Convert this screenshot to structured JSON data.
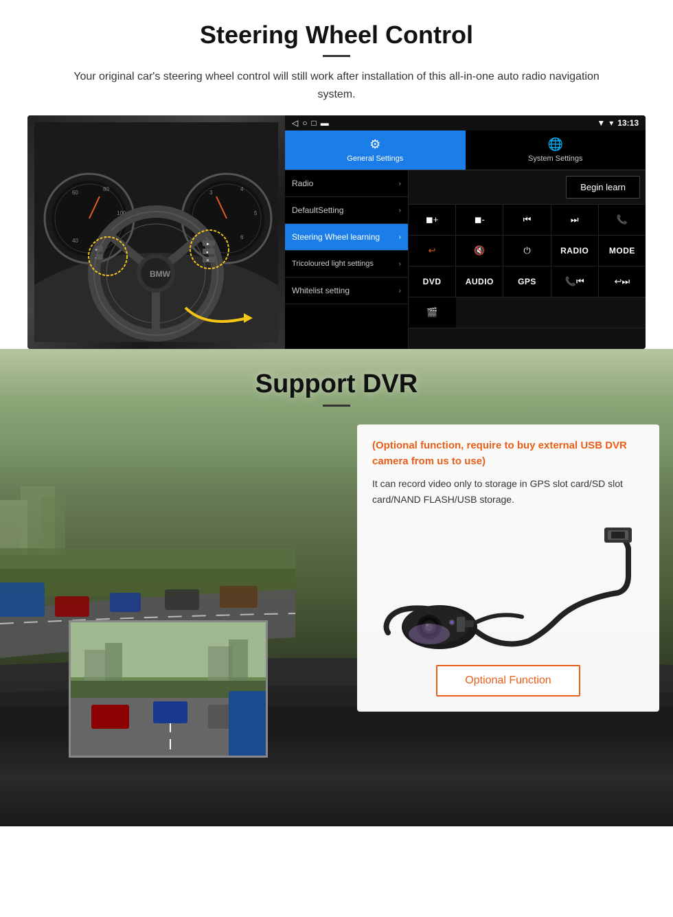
{
  "steering": {
    "title": "Steering Wheel Control",
    "subtitle": "Your original car's steering wheel control will still work after installation of this all-in-one auto radio navigation system.",
    "statusbar": {
      "time": "13:13",
      "signal": "▼",
      "wifi": "▾",
      "battery": "■"
    },
    "nav_icons": [
      "◁",
      "○",
      "□",
      "▬"
    ],
    "tabs": [
      {
        "label": "General Settings",
        "icon": "⚙",
        "active": true
      },
      {
        "label": "System Settings",
        "icon": "🌐",
        "active": false
      }
    ],
    "menu_items": [
      {
        "label": "Radio",
        "active": false
      },
      {
        "label": "DefaultSetting",
        "active": false
      },
      {
        "label": "Steering Wheel learning",
        "active": true
      },
      {
        "label": "Tricoloured light settings",
        "active": false
      },
      {
        "label": "Whitelist setting",
        "active": false
      }
    ],
    "begin_learn": "Begin learn",
    "control_rows": [
      [
        "▐+",
        "▐-",
        "⏮",
        "⏭",
        "📞"
      ],
      [
        "↩",
        "🔇x",
        "⏻",
        "RADIO",
        "MODE"
      ],
      [
        "DVD",
        "AUDIO",
        "GPS",
        "📞⏮",
        "↩⏭"
      ],
      [
        "🎬"
      ]
    ]
  },
  "dvr": {
    "title": "Support DVR",
    "optional_text": "(Optional function, require to buy external USB DVR camera from us to use)",
    "description": "It can record video only to storage in GPS slot card/SD slot card/NAND FLASH/USB storage.",
    "optional_button": "Optional Function"
  }
}
